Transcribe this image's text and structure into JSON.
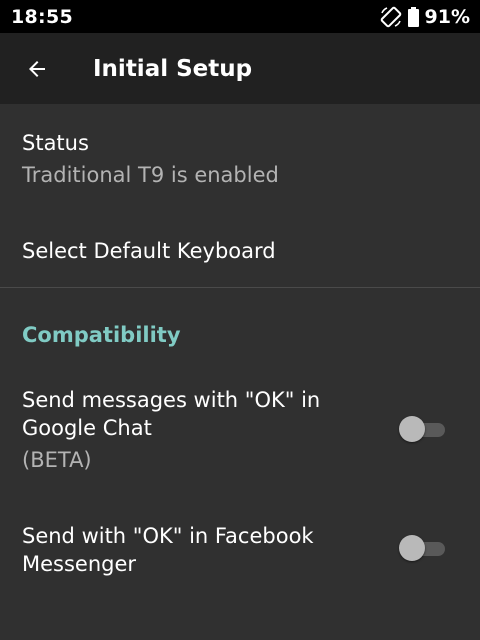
{
  "status_bar": {
    "time": "18:55",
    "battery_percent": "91%",
    "icons": [
      "screen-rotation-icon",
      "battery-icon"
    ]
  },
  "app_bar": {
    "title": "Initial Setup",
    "back_icon": "arrow-back-icon"
  },
  "preferences": {
    "status": {
      "title": "Status",
      "summary": "Traditional T9 is enabled"
    },
    "select_keyboard": {
      "title": "Select Default Keyboard"
    }
  },
  "compatibility": {
    "category_title": "Compatibility",
    "google_chat": {
      "title_line1": "Send messages with \"OK\" in",
      "title_line2": "Google Chat",
      "summary": "(BETA)",
      "enabled": false
    },
    "facebook_messenger": {
      "title_line1": "Send with \"OK\" in Facebook",
      "title_line2": "Messenger",
      "enabled": false
    }
  },
  "colors": {
    "background": "#303030",
    "app_bar": "#212121",
    "status_bar": "#000000",
    "accent": "#80cbc4"
  }
}
